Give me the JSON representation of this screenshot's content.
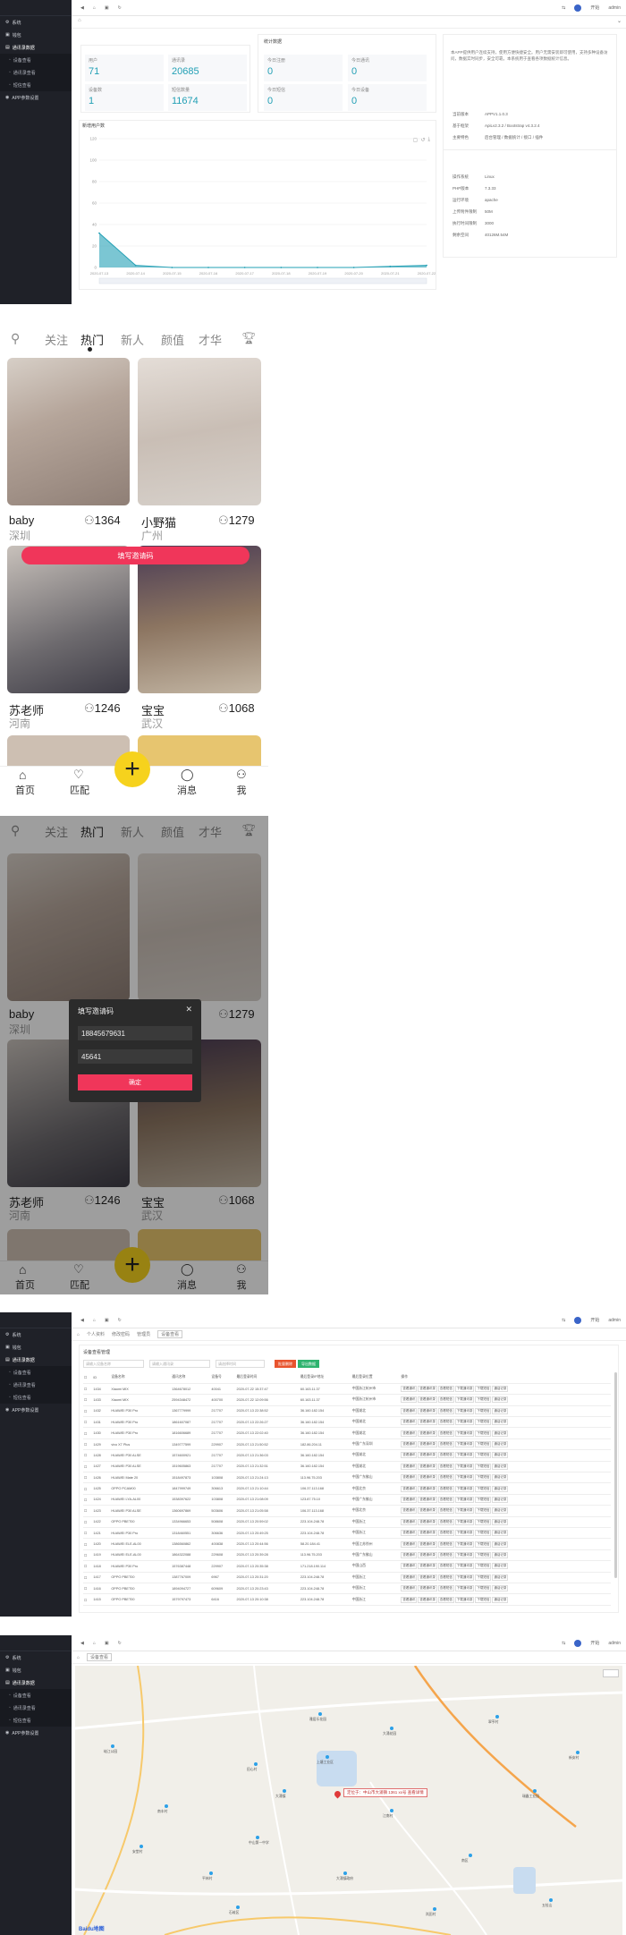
{
  "admin": {
    "menu": [
      {
        "label": "系统",
        "icon": "gear-icon"
      },
      {
        "label": "钱包",
        "icon": "wallet-icon"
      },
      {
        "label": "通讯录数据",
        "icon": "book-icon"
      },
      {
        "label": "设备查看",
        "icon": "device-icon"
      },
      {
        "label": "通讯录查看",
        "icon": "contacts-icon"
      },
      {
        "label": "短信查看",
        "icon": "sms-icon"
      },
      {
        "label": "APP参数设置",
        "icon": "app-icon"
      }
    ],
    "top_right": {
      "lang": "开始",
      "user": "admin"
    }
  },
  "dashboard": {
    "stats": [
      {
        "label": "用户",
        "value": "71"
      },
      {
        "label": "通讯录",
        "value": "20685"
      },
      {
        "label": "设备数",
        "value": "1"
      },
      {
        "label": "短信数量",
        "value": "11674"
      }
    ],
    "stats2_title": "统计数据",
    "stats2": [
      {
        "label": "今日注册",
        "value": "0"
      },
      {
        "label": "今日通讯",
        "value": "0"
      },
      {
        "label": "今日短信",
        "value": "0"
      },
      {
        "label": "今日设备",
        "value": "0"
      }
    ],
    "chart_title": "新增用户数",
    "info_text": "本APP提供用户连续支持，使用方便快捷安全。用户无需安装即可使用，支持多种设备访问，数据实时同步，安全可靠。本系统用于查看各项数据统计信息。",
    "info_rows": [
      {
        "k": "当前版本",
        "v": "APPV1.1.0.3"
      },
      {
        "k": "基于框架",
        "v": "ApiLv2.3.2 / Bootstrap v4.3.2.4"
      },
      {
        "k": "主要特色",
        "v": "后台管理 / 数据统计 / 接口 / 插件"
      }
    ],
    "sys_rows": [
      {
        "k": "操作系统",
        "v": "Linux"
      },
      {
        "k": "PHP版本",
        "v": "7.3.33"
      },
      {
        "k": "运行环境",
        "v": "apache"
      },
      {
        "k": "上传附件限制",
        "v": "50M"
      },
      {
        "k": "执行时间限制",
        "v": "3000"
      },
      {
        "k": "剩余空间",
        "v": "40126M.54M"
      }
    ]
  },
  "chart_data": {
    "type": "area",
    "title": "新增用户数",
    "x": [
      "2020-07-13",
      "2020-07-14",
      "2020-07-15",
      "2020-07-16",
      "2020-07-17",
      "2020-07-18",
      "2020-07-19",
      "2020-07-20",
      "2020-07-21",
      "2020-07-22"
    ],
    "values": [
      32,
      2,
      0,
      0,
      0,
      0,
      0,
      0,
      1,
      2
    ],
    "ylim": [
      0,
      120
    ],
    "yticks": [
      "0",
      "20",
      "40",
      "60",
      "80",
      "100",
      "120"
    ],
    "color": "#23a0b5",
    "grid": true
  },
  "app": {
    "tabs": [
      "关注",
      "热门",
      "新人",
      "颜值",
      "才华"
    ],
    "profiles": [
      {
        "name": "baby",
        "city": "深圳",
        "count": "1364"
      },
      {
        "name": "小野猫",
        "city": "广州",
        "count": "1279"
      },
      {
        "name": "苏老师",
        "city": "河南",
        "count": "1246"
      },
      {
        "name": "宝宝",
        "city": "武汉",
        "count": "1068"
      }
    ],
    "invite_button": "填写邀请码",
    "nav": [
      "首页",
      "匹配",
      "消息",
      "我"
    ],
    "plus": "+"
  },
  "dialog": {
    "title": "填写邀请码",
    "phone": "18845679631",
    "code": "45641",
    "confirm": "确定",
    "close": "✕"
  },
  "devices": {
    "breadcrumb": [
      "个人资料",
      "修改密码",
      "管理员",
      "设备查看"
    ],
    "panel_title": "设备查看管理",
    "search_placeholders": [
      "请输入设备名称",
      "请输入通讯录",
      "请选择时间"
    ],
    "btn_delete": "批量删除",
    "btn_export": "导出数据",
    "headers": [
      "ID",
      "设备名称",
      "通讯名称",
      "设备号",
      "最后登录时间",
      "最后登录IP地址",
      "最后登录位置",
      "操作"
    ],
    "rows": [
      [
        "1434",
        "Xiaomi MIX",
        "1364678012",
        "40041",
        "2020-07-22 15:37:47",
        "60.163.11.37",
        "中国浙江杭州市"
      ],
      [
        "1433",
        "Xiaomi MIX",
        "2594348472",
        "400700",
        "2020-07-22 12:09:56",
        "60.163.11.37",
        "中国浙江杭州市"
      ],
      [
        "1432",
        "HUAWEI P30 Pro",
        "1367779999",
        "217707",
        "2020-07-13 22:38:52",
        "36.160.182.154",
        "中国湖北"
      ],
      [
        "1431",
        "HUAWEI P30 Pro",
        "1861607087",
        "217707",
        "2020-07-13 22:26:27",
        "36.160.182.154",
        "中国湖北"
      ],
      [
        "1430",
        "HUAWEI P30 Pro",
        "1816606689",
        "217707",
        "2020-07-13 22:02:40",
        "36.160.182.154",
        "中国湖北"
      ],
      [
        "1429",
        "vivo X7 Plus",
        "1349777599",
        "229907",
        "2020-07-13 21:50:52",
        "182.86.204.11",
        "中国广东深圳"
      ],
      [
        "1428",
        "HUAWEI P30 ALSE",
        "1574600921",
        "217707",
        "2020-07-13 21:36:03",
        "36.160.182.154",
        "中国湖北"
      ],
      [
        "1427",
        "HUAWEI P30 ALSE",
        "1519605863",
        "217707",
        "2020-07-13 21:32:51",
        "36.160.182.154",
        "中国湖北"
      ],
      [
        "1426",
        "HUAWEI Mate 20",
        "1518497873",
        "103808",
        "2020-07-13 21:24:13",
        "113.96.75.203",
        "中国广东佛山"
      ],
      [
        "1425",
        "OPPO PCAM00",
        "1847999749",
        "306613",
        "2020-07-13 21:10:44",
        "106.37.113.168",
        "中国北京"
      ],
      [
        "1424",
        "HUAWEI LYA-AL00",
        "1538397622",
        "103808",
        "2020-07-13 21:08:09",
        "123.87.75.10",
        "中国广东佛山"
      ],
      [
        "1423",
        "HUAWEI P30 ALSE",
        "1360697869",
        "503606",
        "2020-07-13 21:05:58",
        "106.37.113.168",
        "中国北京"
      ],
      [
        "1422",
        "OPPO PBET00",
        "1334966653",
        "508608",
        "2020-07-13 20:59:02",
        "223.104.248.78",
        "中国浙江"
      ],
      [
        "1421",
        "HUAWEI P30 Pro",
        "1318460551",
        "306636",
        "2020-07-13 20:49:25",
        "223.104.248.78",
        "中国浙江"
      ],
      [
        "1420",
        "HUAWEI ELE-AL00",
        "1386560862",
        "400838",
        "2020-07-13 20:44:56",
        "58.20.184.41",
        "中国江苏徐州"
      ],
      [
        "1419",
        "HUAWEI ELE-AL00",
        "1864322088",
        "229608",
        "2020-07-13 20:39:28",
        "113.96.75.203",
        "中国广东佛山"
      ],
      [
        "1418",
        "HUAWEI P30 Pro",
        "1576387448",
        "229907",
        "2020-07-13 20:35:38",
        "171.218.190.114",
        "中国山西"
      ],
      [
        "1417",
        "OPPO PBET00",
        "1387767009",
        "6967",
        "2020-07-13 20:31:20",
        "223.104.248.78",
        "中国浙江"
      ],
      [
        "1416",
        "OPPO PBET00",
        "1894094727",
        "609609",
        "2020-07-13 20:23:43",
        "223.104.248.78",
        "中国浙江"
      ],
      [
        "1415",
        "OPPO PBET00",
        "1579797473",
        "6416",
        "2020-07-13 20:10:38",
        "223.104.248.78",
        "中国浙江"
      ]
    ],
    "actions": [
      "查看通讯",
      "查看通讯录",
      "查看短信",
      "下载通讯录",
      "下载短信",
      "通话记录"
    ]
  },
  "map": {
    "page_title": "设备查看",
    "marker_label": "定位于：中山市大涌镇 1361 xx号 查看详情",
    "logo": "Baidu地图",
    "pois": [
      "雅居乐花园",
      "大涌花园",
      "上塘工业区",
      "田心村",
      "岐江公园",
      "大涌镇",
      "南丰村",
      "安堂村",
      "中山第一中学",
      "石岐区",
      "江南村",
      "瑞鑫工业园",
      "南区",
      "五桂山",
      "翠亨村",
      "大涌镇政府",
      "新安村",
      "平林村",
      "岚田村"
    ]
  },
  "colors": {
    "sidebar": "#1f2128",
    "accent": "#23a0b5",
    "pink": "#f0365a",
    "yellow": "#f6d21d"
  }
}
